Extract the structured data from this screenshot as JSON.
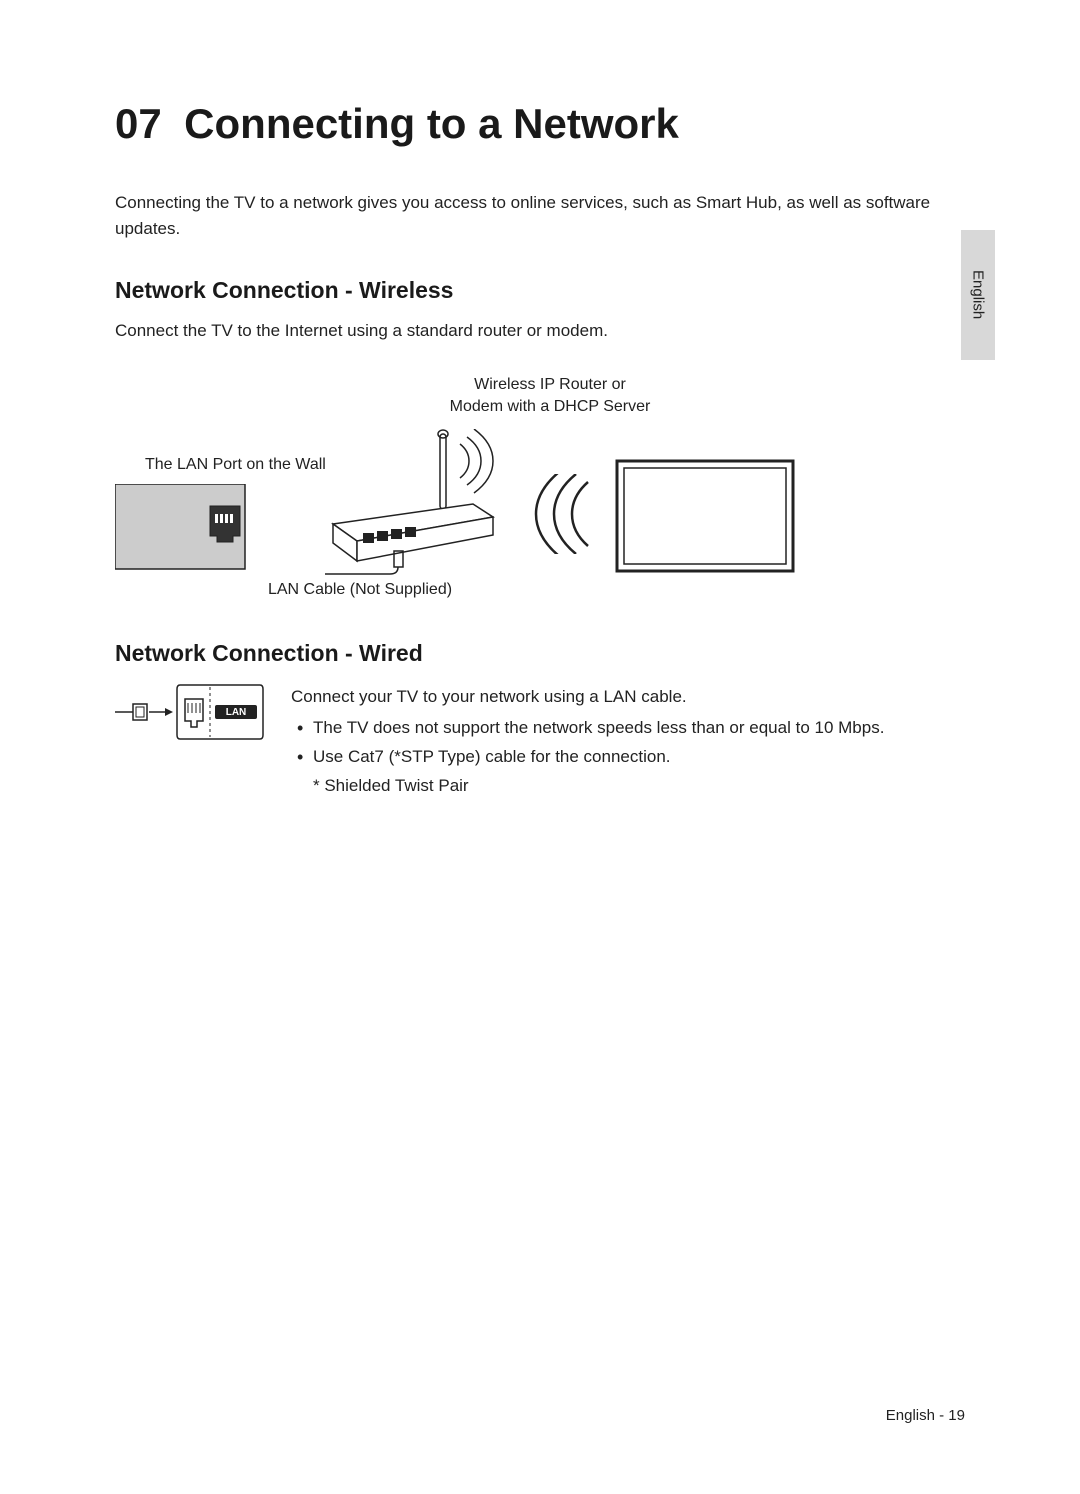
{
  "chapter": {
    "number": "07",
    "title": "Connecting to a Network"
  },
  "intro": "Connecting the TV to a network gives you access to online services, such as Smart Hub, as well as software updates.",
  "wireless": {
    "heading": "Network Connection - Wireless",
    "body": "Connect the TV to the Internet using a standard router or modem.",
    "labels": {
      "router_line1": "Wireless IP Router or",
      "router_line2": "Modem with a DHCP Server",
      "lan_port": "The LAN Port on the Wall",
      "lan_cable": "LAN Cable (Not Supplied)"
    }
  },
  "wired": {
    "heading": "Network Connection - Wired",
    "intro": "Connect your TV to your network using a LAN cable.",
    "bullets": [
      "The TV does not support the network speeds less than or equal to 10 Mbps.",
      "Use Cat7 (*STP Type) cable for the connection."
    ],
    "footnote": "* Shielded Twist Pair",
    "port_label": "LAN"
  },
  "side_tab": "English",
  "page_number": "English - 19"
}
